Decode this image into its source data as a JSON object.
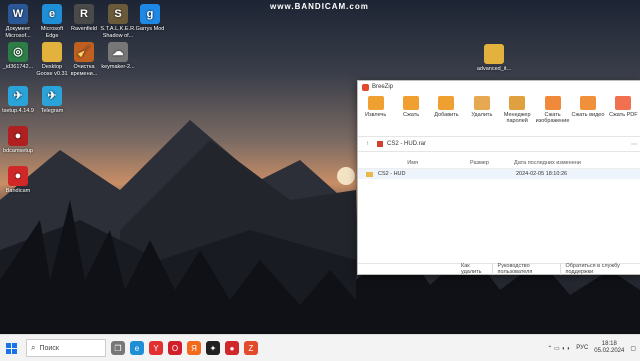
{
  "watermark": "www.BANDICAM.com",
  "desktop_icons": [
    {
      "label": "Документ Microsof...",
      "name": "word-document-icon",
      "color": "#2b5797",
      "glyph": "W"
    },
    {
      "label": "Microsoft Edge",
      "name": "edge-icon",
      "color": "#1e8fd6",
      "glyph": "e"
    },
    {
      "label": "Ravenfield",
      "name": "ravenfield-icon",
      "color": "#4a4a4a",
      "glyph": "R"
    },
    {
      "label": "S.T.A.L.K.E.R. Shadow of...",
      "name": "stalker-icon",
      "color": "#6a5a3a",
      "glyph": "S"
    },
    {
      "label": "Garrys Mod",
      "name": "garrys-mod-icon",
      "color": "#1e88e5",
      "glyph": "g"
    },
    {
      "label": "_id361742...",
      "name": "exe-file-icon",
      "color": "#2d7d46",
      "glyph": "◎"
    },
    {
      "label": "Desktop Goose v0.31",
      "name": "folder-icon",
      "color": "#e3b23c",
      "glyph": ""
    },
    {
      "label": "Очистка времени...",
      "name": "cleanup-icon",
      "color": "#c06020",
      "glyph": "🧹"
    },
    {
      "label": "keymaker-2...",
      "name": "keymaker-icon",
      "color": "#777",
      "glyph": "☁"
    },
    {
      "label": "advanced_it...",
      "name": "archive-folder-icon",
      "color": "#e3b23c",
      "glyph": ""
    },
    {
      "label": "tsetup.4.14.9",
      "name": "telegram-setup-icon",
      "color": "#2aa3d9",
      "glyph": "✈"
    },
    {
      "label": "Telegram",
      "name": "telegram-icon",
      "color": "#2aa3d9",
      "glyph": "✈"
    },
    {
      "label": "bdcamsetup",
      "name": "bandicam-setup-icon",
      "color": "#b02020",
      "glyph": "●"
    },
    {
      "label": "Bandicam",
      "name": "bandicam-icon",
      "color": "#d02828",
      "glyph": "●"
    }
  ],
  "window": {
    "title": "BreeZip",
    "toolbar": [
      {
        "label": "Извлечь",
        "name": "extract-button",
        "color": "#f0a030"
      },
      {
        "label": "Сжать",
        "name": "compress-button",
        "color": "#f0a030"
      },
      {
        "label": "Добавить",
        "name": "add-button",
        "color": "#f0a030"
      },
      {
        "label": "Удалить",
        "name": "delete-button",
        "color": "#e6a850"
      },
      {
        "label": "Менеджер паролей",
        "name": "password-manager-button",
        "color": "#e0a040"
      },
      {
        "label": "Сжать изображение",
        "name": "compress-image-button",
        "color": "#f08a3a"
      },
      {
        "label": "Сжать видео",
        "name": "compress-video-button",
        "color": "#f0903a"
      },
      {
        "label": "Сжать PDF",
        "name": "compress-pdf-button",
        "color": "#f07050"
      }
    ],
    "path": "CS2 - HUD.rar",
    "columns": {
      "name": "Имя",
      "size": "Размер",
      "date": "Дата последних изменени"
    },
    "rows": [
      {
        "name": "CS2 - HUD",
        "size": "",
        "date": "2024-02-05 18:10:26"
      }
    ],
    "status": [
      "Как удалить",
      "Руководство пользователя",
      "Обратиться в службу поддержки"
    ]
  },
  "taskbar": {
    "search_placeholder": "Поиск",
    "apps": [
      {
        "name": "task-view-icon",
        "color": "#777",
        "glyph": "❐"
      },
      {
        "name": "edge-taskbar-icon",
        "color": "#1e8fd6",
        "glyph": "e"
      },
      {
        "name": "yandex-taskbar-icon",
        "color": "#e23030",
        "glyph": "Y"
      },
      {
        "name": "opera-taskbar-icon",
        "color": "#d21d2a",
        "glyph": "O"
      },
      {
        "name": "yandex-browser-taskbar-icon",
        "color": "#f26a1b",
        "glyph": "Я"
      },
      {
        "name": "game-taskbar-icon",
        "color": "#202020",
        "glyph": "✦"
      },
      {
        "name": "bandicam-taskbar-icon",
        "color": "#d02828",
        "glyph": "●"
      },
      {
        "name": "breezip-taskbar-icon",
        "color": "#e24a2c",
        "glyph": "Z"
      }
    ],
    "language": "РУС",
    "time": "18:18",
    "date": "05.02.2024"
  }
}
